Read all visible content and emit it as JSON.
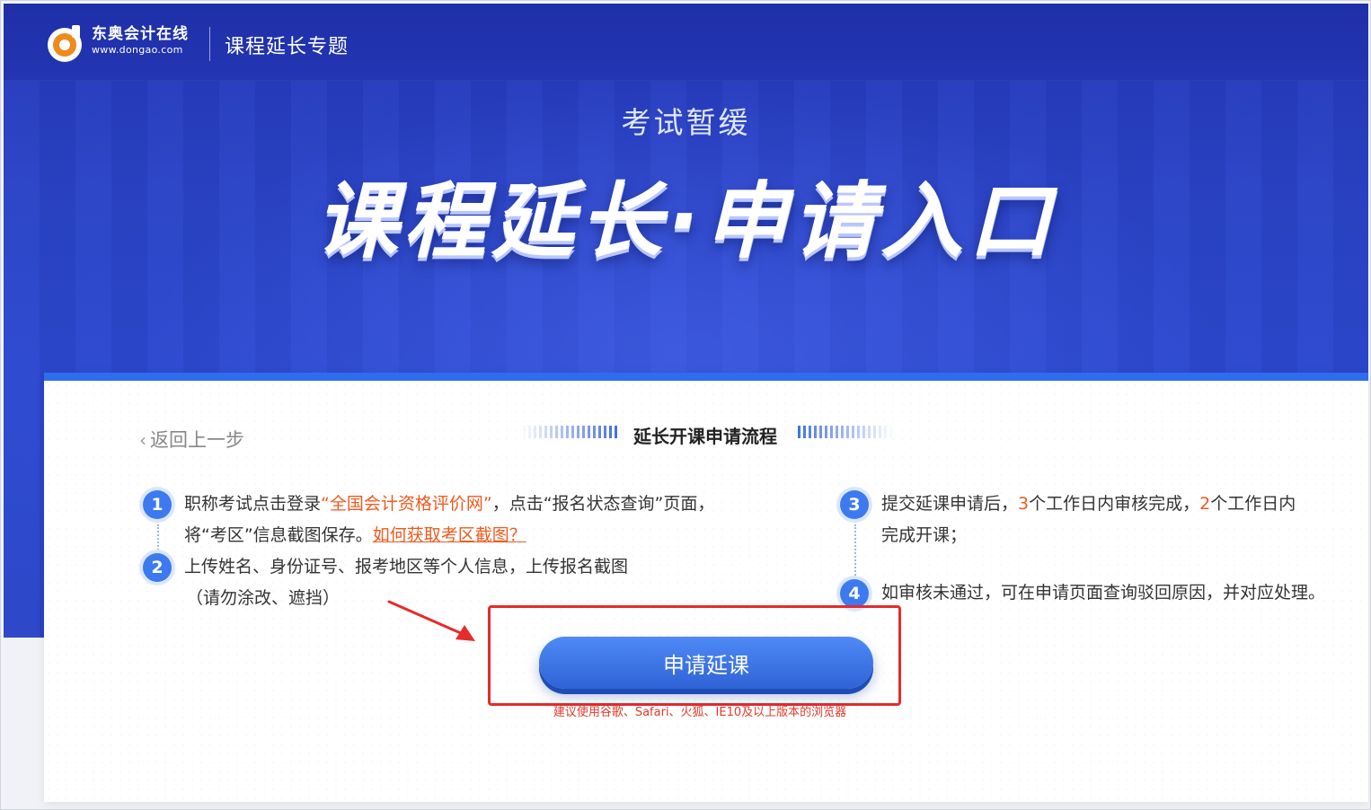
{
  "header": {
    "logo_name": "东奥会计在线",
    "logo_url": "www.dongao.com",
    "title": "课程延长专题"
  },
  "hero": {
    "kicker": "考试暂缓",
    "title": "课程延长·申请入口"
  },
  "card": {
    "back_label": "返回上一步",
    "flow_title": "延长开课申请流程",
    "steps": [
      {
        "num": "1",
        "line1_prefix": "职称考试点击登录",
        "line1_highlight": "“全国会计资格评价网”",
        "line1_suffix": "，点击“报名状态查询”页面，",
        "line2_prefix": "将“考区”信息截图保存。",
        "line2_link": "如何获取考区截图？"
      },
      {
        "num": "2",
        "line1": "上传姓名、身份证号、报考地区等个人信息，上传报名截图",
        "line2": "（请勿涂改、遮挡）"
      },
      {
        "num": "3",
        "line1_prefix": "提交延课申请后，",
        "line1_num1": "3",
        "line1_mid": "个工作日内审核完成，",
        "line1_num2": "2",
        "line1_suffix": "个工作日内",
        "line2": "完成开课；"
      },
      {
        "num": "4",
        "line1": "如审核未通过，可在申请页面查询驳回原因，并对应处理。"
      }
    ],
    "cta_label": "申请延课",
    "browser_tip": "建议使用谷歌、Safari、火狐、IE10及以上版本的浏览器"
  },
  "colors": {
    "banner": "#2a43c7",
    "accent": "#3d7af0",
    "highlight": "#f05a1e",
    "annotation": "#e52b2b"
  }
}
